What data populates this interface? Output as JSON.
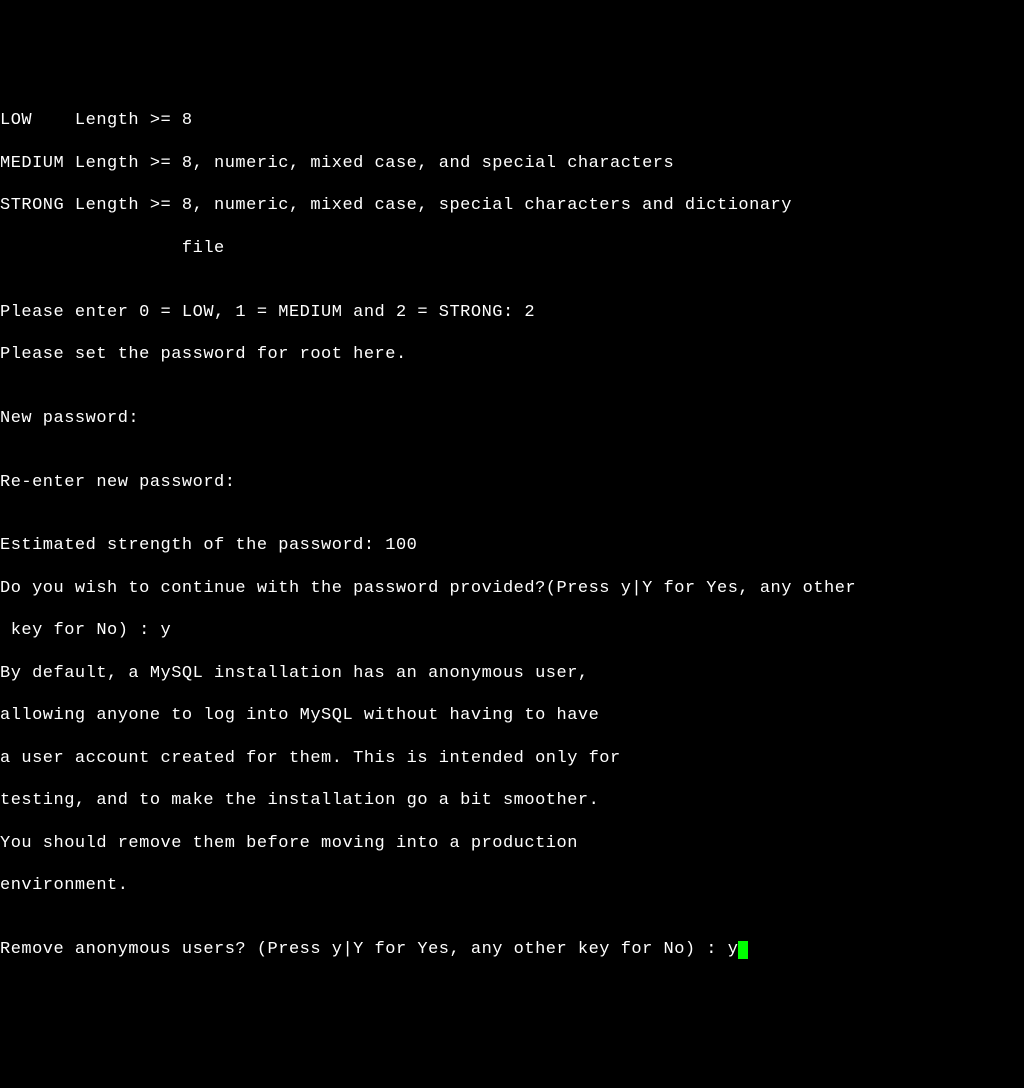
{
  "terminal": {
    "line1": "LOW    Length >= 8",
    "line2": "MEDIUM Length >= 8, numeric, mixed case, and special characters",
    "line3": "STRONG Length >= 8, numeric, mixed case, special characters and dictionary",
    "line4": "                 file",
    "line5": "",
    "line6_prompt": "Please enter 0 = LOW, 1 = MEDIUM and 2 = STRONG: ",
    "line6_input": "2",
    "line7": "Please set the password for root here.",
    "line8": "",
    "line9": "New password:",
    "line10": "",
    "line11": "Re-enter new password:",
    "line12": "",
    "line13": "Estimated strength of the password: 100",
    "line14_prompt": "Do you wish to continue with the password provided?(Press y|Y for Yes, any other",
    "line15_prompt": " key for No) : ",
    "line15_input": "y",
    "line16": "By default, a MySQL installation has an anonymous user,",
    "line17": "allowing anyone to log into MySQL without having to have",
    "line18": "a user account created for them. This is intended only for",
    "line19": "testing, and to make the installation go a bit smoother.",
    "line20": "You should remove them before moving into a production",
    "line21": "environment.",
    "line22": "",
    "line23_prompt": "Remove anonymous users? (Press y|Y for Yes, any other key for No) : ",
    "line23_input": "y"
  }
}
